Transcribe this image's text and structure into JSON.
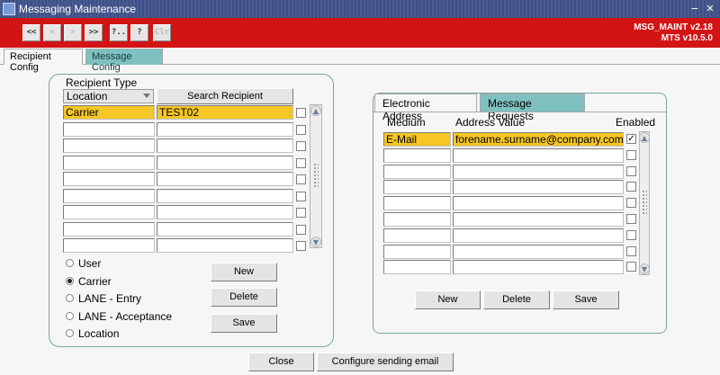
{
  "window": {
    "title": "Messaging Maintenance",
    "controls": [
      "minimize-icon",
      "close-icon"
    ]
  },
  "toolbar": {
    "nav_buttons": [
      {
        "label": "<<",
        "name": "first-record-button",
        "enabled": true
      },
      {
        "label": "<",
        "name": "previous-record-button",
        "enabled": false
      },
      {
        "label": ">",
        "name": "next-record-button",
        "enabled": false
      },
      {
        "label": ">>",
        "name": "last-record-button",
        "enabled": true
      },
      {
        "label": "?..",
        "name": "query-button",
        "enabled": true
      },
      {
        "label": "?",
        "name": "help-button",
        "enabled": true
      },
      {
        "label": "Clr",
        "name": "clear-button",
        "enabled": false
      }
    ],
    "version_line1": "MSG_MAINT v2.18",
    "version_line2": "MTS v10.5.0"
  },
  "tabs": [
    {
      "label": "Recipient Config",
      "active": true
    },
    {
      "label": "Message Config",
      "active": false
    }
  ],
  "recipient": {
    "type_label": "Recipient Type",
    "type_selected": "Location",
    "search_button": "Search Recipient",
    "rows": [
      {
        "type": "Carrier",
        "id": "TEST02",
        "selected": true
      },
      {
        "type": "",
        "id": "",
        "selected": false
      },
      {
        "type": "",
        "id": "",
        "selected": false
      },
      {
        "type": "",
        "id": "",
        "selected": false
      },
      {
        "type": "",
        "id": "",
        "selected": false
      },
      {
        "type": "",
        "id": "",
        "selected": false
      },
      {
        "type": "",
        "id": "",
        "selected": false
      },
      {
        "type": "",
        "id": "",
        "selected": false
      },
      {
        "type": "",
        "id": "",
        "selected": false
      }
    ],
    "radio_options": [
      {
        "label": "User",
        "checked": false
      },
      {
        "label": "Carrier",
        "checked": true
      },
      {
        "label": "LANE - Entry",
        "checked": false
      },
      {
        "label": "LANE - Acceptance",
        "checked": false
      },
      {
        "label": "Location",
        "checked": false
      }
    ],
    "buttons": {
      "new": "New",
      "delete": "Delete",
      "save": "Save"
    }
  },
  "address": {
    "subtabs": [
      {
        "label": "Electronic Address",
        "active": true
      },
      {
        "label": "Message Requests",
        "active": false
      }
    ],
    "columns": {
      "medium": "Medium",
      "value": "Address Value",
      "enabled": "Enabled"
    },
    "rows": [
      {
        "medium": "E-Mail",
        "value": "forename.surname@company.com",
        "enabled": true,
        "selected": true
      },
      {
        "medium": "",
        "value": "",
        "enabled": false,
        "selected": false
      },
      {
        "medium": "",
        "value": "",
        "enabled": false,
        "selected": false
      },
      {
        "medium": "",
        "value": "",
        "enabled": false,
        "selected": false
      },
      {
        "medium": "",
        "value": "",
        "enabled": false,
        "selected": false
      },
      {
        "medium": "",
        "value": "",
        "enabled": false,
        "selected": false
      },
      {
        "medium": "",
        "value": "",
        "enabled": false,
        "selected": false
      },
      {
        "medium": "",
        "value": "",
        "enabled": false,
        "selected": false
      },
      {
        "medium": "",
        "value": "",
        "enabled": false,
        "selected": false
      }
    ],
    "buttons": {
      "new": "New",
      "delete": "Delete",
      "save": "Save"
    }
  },
  "footer": {
    "close": "Close",
    "configure": "Configure sending email"
  },
  "colors": {
    "toolbar": "#d21414",
    "selected_row": "#f5c624",
    "inactive_tab": "#7fc0c0",
    "titlebar": "#3c4f87"
  }
}
